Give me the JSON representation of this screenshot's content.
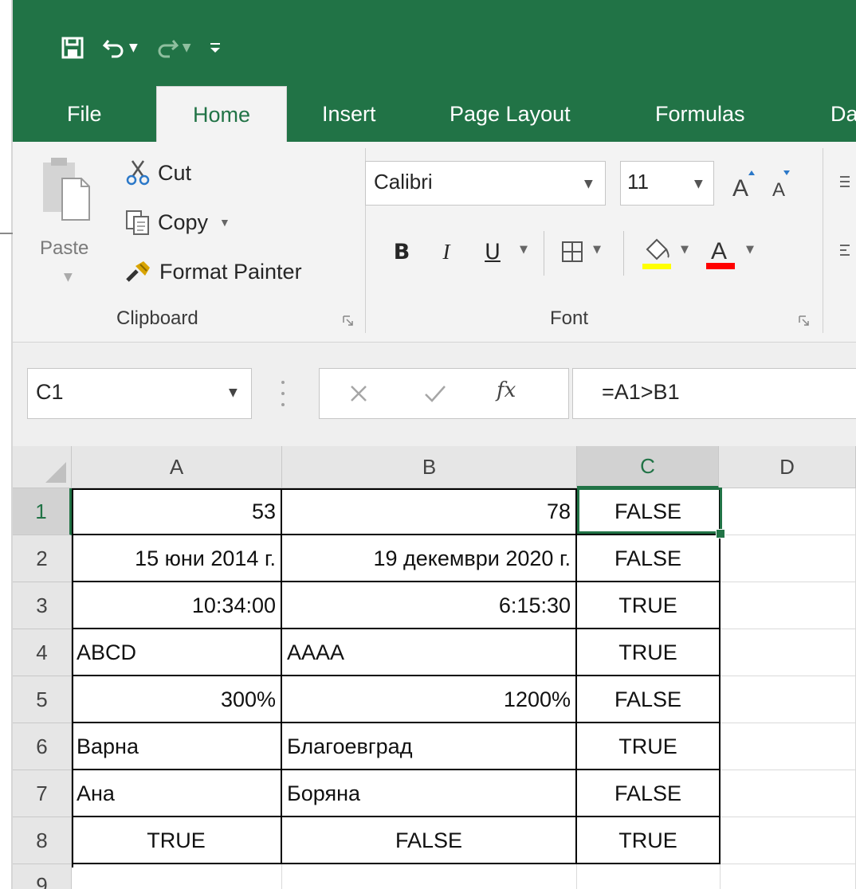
{
  "colors": {
    "excel_green": "#217346",
    "ribbon_bg": "#f3f3f3",
    "header_bg": "#e6e6e6",
    "highlight_yellow": "#ffff00",
    "font_red": "#ff0000"
  },
  "quick_access": {
    "save": "save-icon",
    "undo": "undo-icon",
    "redo": "redo-icon",
    "customize": "customize-qat-icon"
  },
  "tabs": [
    {
      "label": "File"
    },
    {
      "label": "Home"
    },
    {
      "label": "Insert"
    },
    {
      "label": "Page Layout"
    },
    {
      "label": "Formulas"
    },
    {
      "label": "Da"
    }
  ],
  "clipboard": {
    "paste": "Paste",
    "cut": "Cut",
    "copy": "Copy",
    "format_painter": "Format Painter",
    "group_label": "Clipboard"
  },
  "font": {
    "name": "Calibri",
    "size": "11",
    "bold": "B",
    "italic": "I",
    "underline": "U",
    "group_label": "Font"
  },
  "formula_bar": {
    "name_box": "C1",
    "fx": "fx",
    "formula": "=A1>B1"
  },
  "columns": [
    "A",
    "B",
    "C",
    "D"
  ],
  "rows": [
    "1",
    "2",
    "3",
    "4",
    "5",
    "6",
    "7",
    "8",
    "9"
  ],
  "cells": [
    [
      "53",
      "78",
      "FALSE"
    ],
    [
      "15 юни 2014 г.",
      "19 декември 2020 г.",
      "FALSE"
    ],
    [
      "10:34:00",
      "6:15:30",
      "TRUE"
    ],
    [
      "ABCD",
      "AAAA",
      "TRUE"
    ],
    [
      "300%",
      "1200%",
      "FALSE"
    ],
    [
      "Варна",
      "Благоевград",
      "TRUE"
    ],
    [
      "Ана",
      "Боряна",
      "FALSE"
    ],
    [
      "TRUE",
      "FALSE",
      "TRUE"
    ]
  ]
}
